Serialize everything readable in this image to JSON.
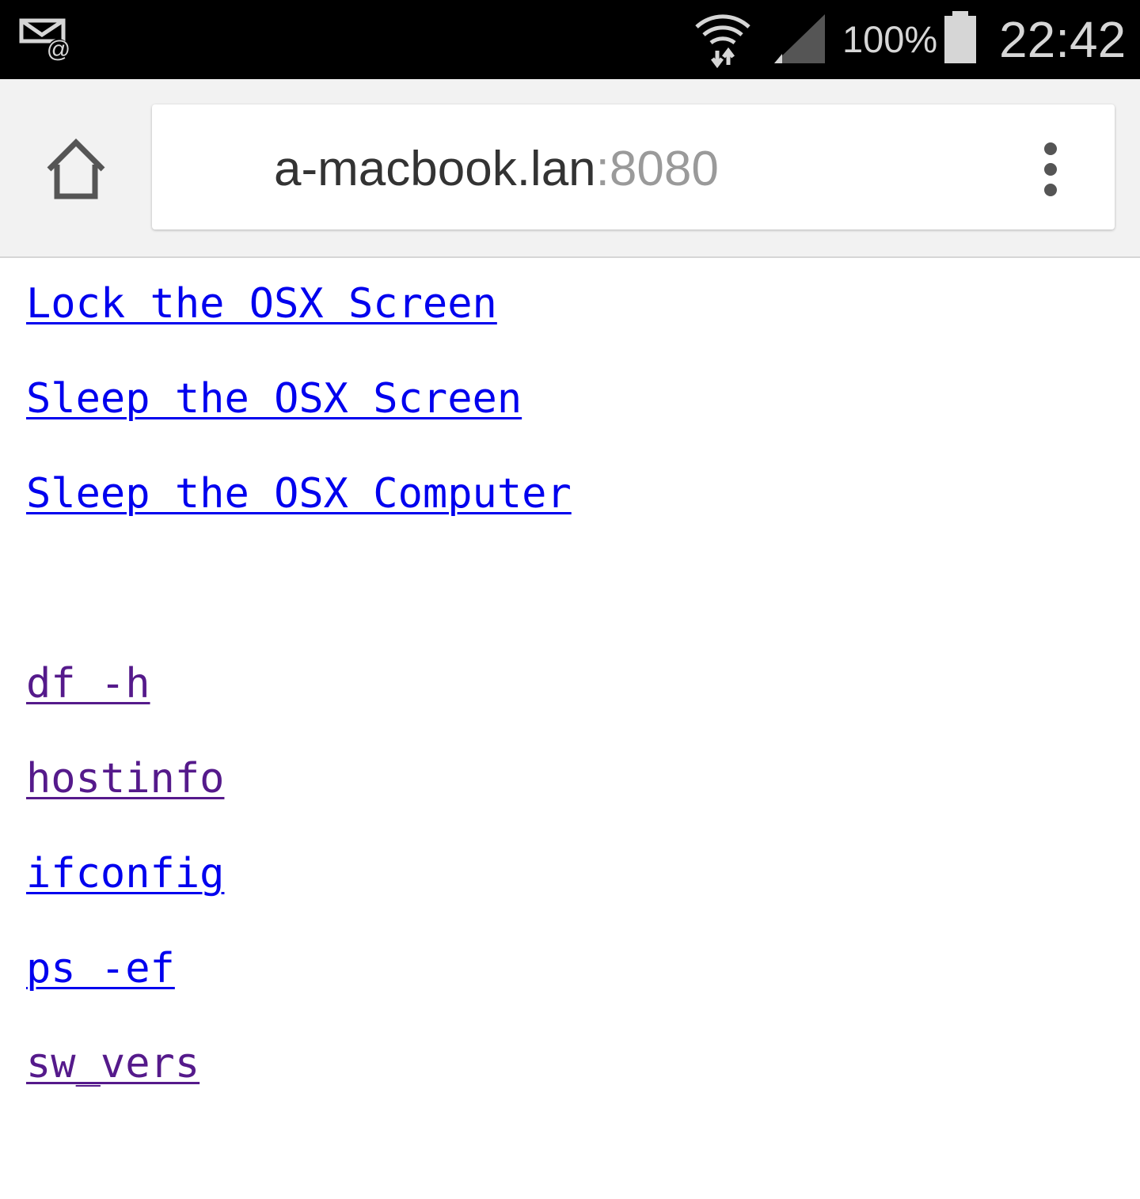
{
  "status_bar": {
    "notification_icon": "mail-at-icon",
    "wifi_icon": "wifi-data-icon",
    "signal_icon": "cell-signal-icon",
    "battery_percent": "100%",
    "battery_icon": "battery-icon",
    "time": "22:42"
  },
  "browser": {
    "home_icon": "home-icon",
    "url": {
      "host": "a-macbook.lan",
      "port": ":8080"
    },
    "menu_icon": "overflow-menu-icon"
  },
  "links_primary": [
    {
      "label": "Lock the OSX Screen",
      "visited": false
    },
    {
      "label": "Sleep the OSX Screen",
      "visited": false
    },
    {
      "label": "Sleep the OSX Computer",
      "visited": false
    }
  ],
  "links_commands": [
    {
      "label": "df -h",
      "visited": true
    },
    {
      "label": "hostinfo",
      "visited": true
    },
    {
      "label": "ifconfig",
      "visited": false
    },
    {
      "label": "ps -ef",
      "visited": false
    },
    {
      "label": "sw_vers",
      "visited": true
    }
  ],
  "colors": {
    "link_unvisited": "#0000ee",
    "link_visited": "#551a8b",
    "status_bar_bg": "#000000",
    "toolbar_bg": "#f2f2f2"
  }
}
